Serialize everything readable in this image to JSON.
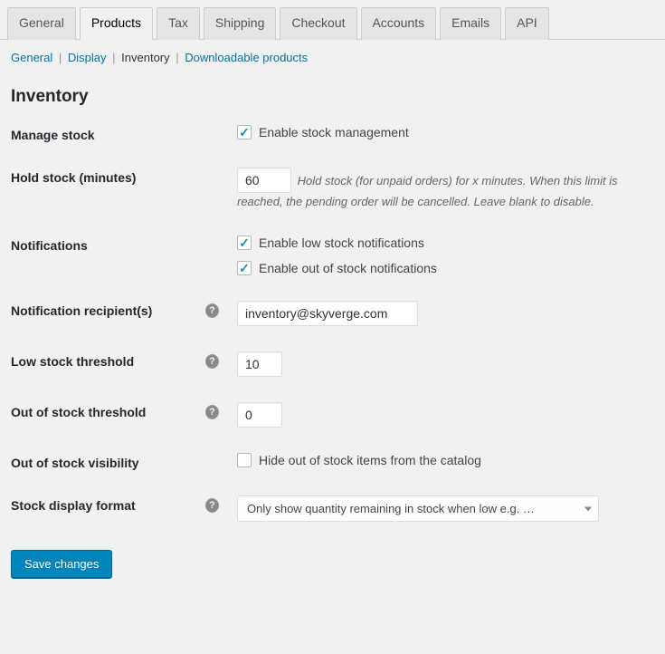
{
  "tabs": {
    "general": "General",
    "products": "Products",
    "tax": "Tax",
    "shipping": "Shipping",
    "checkout": "Checkout",
    "accounts": "Accounts",
    "emails": "Emails",
    "api": "API"
  },
  "subnav": {
    "general": "General",
    "display": "Display",
    "inventory": "Inventory",
    "downloadable": "Downloadable products"
  },
  "section_title": "Inventory",
  "fields": {
    "manage_stock": {
      "label": "Manage stock",
      "checkbox_label": "Enable stock management"
    },
    "hold_stock": {
      "label": "Hold stock (minutes)",
      "value": "60",
      "desc": "Hold stock (for unpaid orders) for x minutes. When this limit is reached, the pending order will be cancelled. Leave blank to disable."
    },
    "notifications": {
      "label": "Notifications",
      "low_label": "Enable low stock notifications",
      "out_label": "Enable out of stock notifications"
    },
    "recipient": {
      "label": "Notification recipient(s)",
      "value": "inventory@skyverge.com"
    },
    "low_threshold": {
      "label": "Low stock threshold",
      "value": "10"
    },
    "out_threshold": {
      "label": "Out of stock threshold",
      "value": "0"
    },
    "out_visibility": {
      "label": "Out of stock visibility",
      "checkbox_label": "Hide out of stock items from the catalog"
    },
    "stock_format": {
      "label": "Stock display format",
      "value": "Only show quantity remaining in stock when low e.g. …"
    }
  },
  "save_button": "Save changes"
}
